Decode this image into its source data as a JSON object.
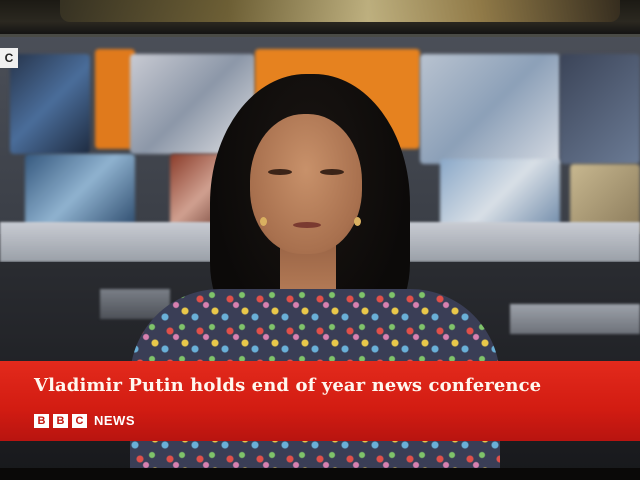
{
  "corner_badge": "C",
  "lower_third": {
    "headline": "Vladimir Putin holds end of year news conference",
    "brand_letters": [
      "B",
      "B",
      "C"
    ],
    "brand_text": "NEWS"
  },
  "colors": {
    "banner_red": "#d21c12",
    "banner_text": "#fff7ef"
  }
}
